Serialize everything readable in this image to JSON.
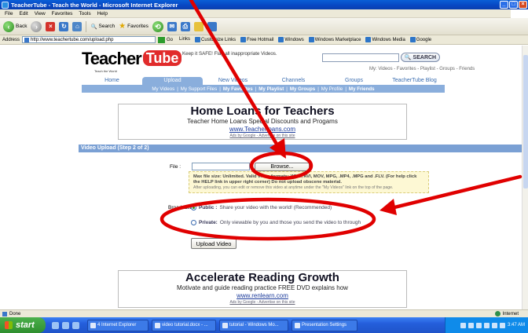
{
  "window": {
    "title": "TeacherTube - Teach the World - Microsoft Internet Explorer"
  },
  "menu": [
    "File",
    "Edit",
    "View",
    "Favorites",
    "Tools",
    "Help"
  ],
  "toolbar": {
    "back": "Back",
    "search": "Search",
    "favorites": "Favorites"
  },
  "address": {
    "label": "Address",
    "url": "http://www.teachertube.com/upload.php",
    "go": "Go",
    "links_label": "Links",
    "links": [
      "Customize Links",
      "Free Hotmail",
      "Windows",
      "Windows Marketplace",
      "Windows Media",
      "Google"
    ]
  },
  "site": {
    "logo_main": "Teacher",
    "logo_tube": "Tube",
    "logo_sub": "Teach the World",
    "tagline": "Keep it SAFE! Flag all inappropriate Videos.",
    "search_button": "SEARCH",
    "my_links": "My:  Videos  -  Favorites  -  Playlist  -  Groups  -  Friends",
    "nav_tabs": [
      "Home",
      "Upload",
      "New Videos",
      "Channels",
      "Groups",
      "TeacherTube Blog"
    ],
    "sub_nav": [
      "My Videos",
      "My Support Files",
      "My Favorites",
      "My Playlist",
      "My Groups",
      "My Profile",
      "My Friends"
    ]
  },
  "ad_top": {
    "headline": "Home Loans for Teachers",
    "desc": "Teacher Home Loans Special Discounts and Progams",
    "url": "www.Teacherloans.com",
    "google": "Ads by Google - Advertise on this site"
  },
  "section_title": "Video Upload (Step 2 of 2)",
  "form": {
    "file_label": "File :",
    "browse_label": "Browse...",
    "info_line1": "Max file size: Unlimited. Valid video formats: WMV, AVI, MOV, MPG, .MP4, .MPG and .FLV. (For help click",
    "info_line2": "the HELP link in upper right corner) Do not upload obscene material.",
    "info_line3": "After uploading, you can edit or remove this video at anytime under the \"My Videos\" link on the top of the page.",
    "broadcast_label": "Broadcast:",
    "public_strong": "Public :",
    "public_text": "Share your video with the world! (Recommended)",
    "private_strong": "Private:",
    "private_text": "Only viewable by you and those you send the video to through",
    "upload_button": "Upload Video"
  },
  "ad_bottom": {
    "headline": "Accelerate Reading Growth",
    "desc": "Motivate and guide reading practice FREE DVD explains how",
    "url": "www.renlearn.com",
    "google": "Ads by Google - Advertise on this site"
  },
  "status": {
    "text": "Done",
    "zone": "Internet"
  },
  "taskbar": {
    "start": "start",
    "tasks": [
      "4 Internet Explorer",
      "video tutorial.docx - ...",
      "tutorial - Windows Mo...",
      "Presentation Settings"
    ],
    "clock": "3:47 AM"
  },
  "colors": {
    "annotation": "#e00000",
    "nav_blue": "#8aaedc",
    "section_bar": "#7aa0d4"
  }
}
